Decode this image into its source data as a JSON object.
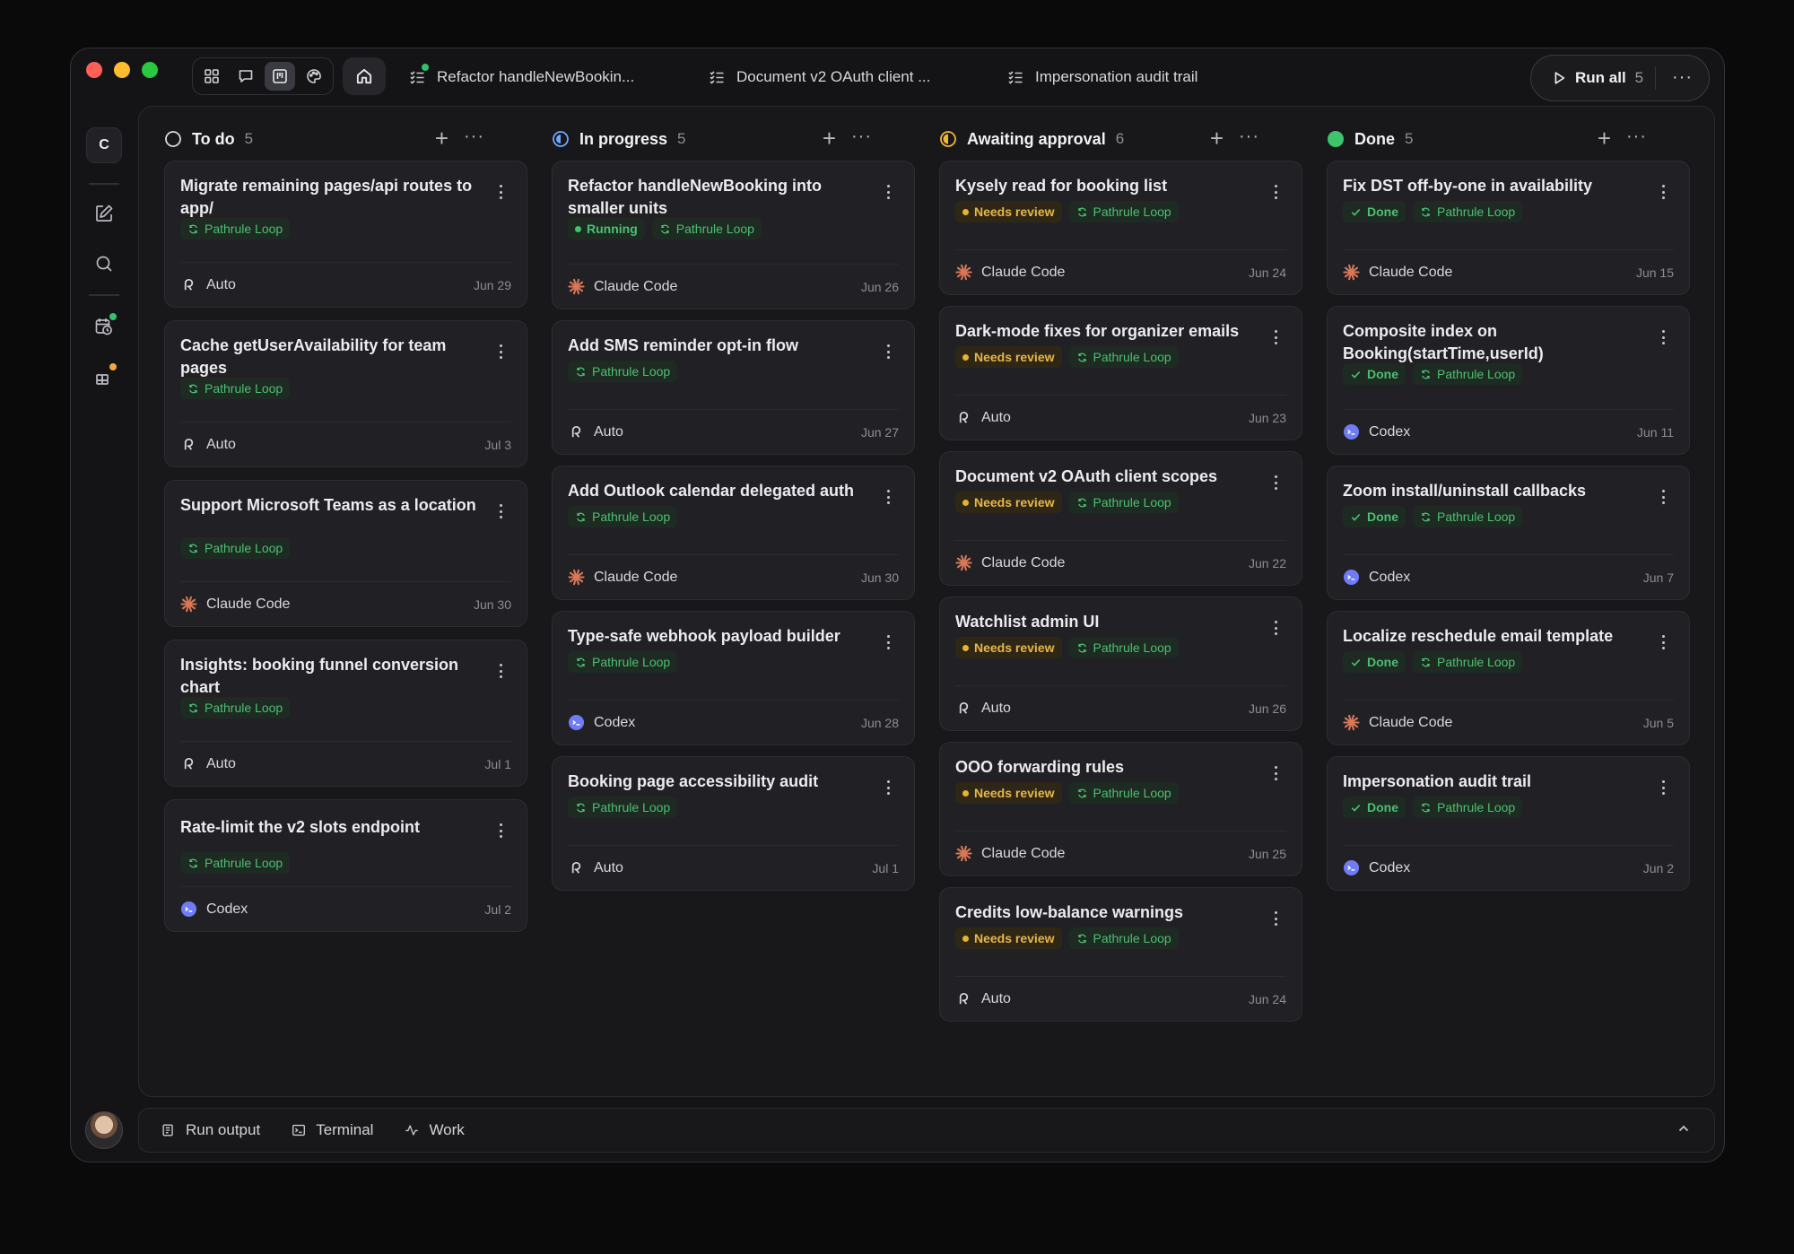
{
  "tabs": [
    {
      "label": "Refactor handleNewBookin...",
      "running": true
    },
    {
      "label": "Document v2 OAuth client ..."
    },
    {
      "label": "Impersonation audit trail"
    }
  ],
  "toolbar": {
    "run_all_label": "Run all",
    "run_all_count": "5"
  },
  "sidebar": {
    "workspace_initial": "C"
  },
  "columns": [
    {
      "name": "To do",
      "count": "5",
      "status_color": "#d8d8dc",
      "cards": [
        {
          "title": "Migrate remaining pages/api routes to app/",
          "tags": [
            "Pathrule Loop"
          ],
          "agent": "Auto",
          "date": "Jun 29"
        },
        {
          "title": "Cache getUserAvailability for team pages",
          "tags": [
            "Pathrule Loop"
          ],
          "agent": "Auto",
          "date": "Jul 3"
        },
        {
          "title": "Support Microsoft Teams as a location",
          "tags": [
            "Pathrule Loop"
          ],
          "agent": "Claude Code",
          "date": "Jun 30"
        },
        {
          "title": "Insights: booking funnel conversion chart",
          "tags": [
            "Pathrule Loop"
          ],
          "agent": "Auto",
          "date": "Jul 1"
        },
        {
          "title": "Rate-limit the v2 slots endpoint",
          "tags": [
            "Pathrule Loop"
          ],
          "agent": "Codex",
          "date": "Jul 2"
        }
      ]
    },
    {
      "name": "In progress",
      "count": "5",
      "status_color": "#6ea8ff",
      "cards": [
        {
          "title": "Refactor handleNewBooking into smaller units",
          "status": "Running",
          "tags": [
            "Pathrule Loop"
          ],
          "agent": "Claude Code",
          "date": "Jun 26"
        },
        {
          "title": "Add SMS reminder opt-in flow",
          "tags": [
            "Pathrule Loop"
          ],
          "agent": "Auto",
          "date": "Jun 27"
        },
        {
          "title": "Add Outlook calendar delegated auth",
          "tags": [
            "Pathrule Loop"
          ],
          "agent": "Claude Code",
          "date": "Jun 30"
        },
        {
          "title": "Type-safe webhook payload builder",
          "tags": [
            "Pathrule Loop"
          ],
          "agent": "Codex",
          "date": "Jun 28"
        },
        {
          "title": "Booking page accessibility audit",
          "tags": [
            "Pathrule Loop"
          ],
          "agent": "Auto",
          "date": "Jul 1"
        }
      ]
    },
    {
      "name": "Awaiting approval",
      "count": "6",
      "status_color": "#f0b53a",
      "cards": [
        {
          "title": "Kysely read for booking list",
          "status": "Needs review",
          "tags": [
            "Pathrule Loop"
          ],
          "agent": "Claude Code",
          "date": "Jun 24"
        },
        {
          "title": "Dark-mode fixes for organizer emails",
          "status": "Needs review",
          "tags": [
            "Pathrule Loop"
          ],
          "agent": "Auto",
          "date": "Jun 23"
        },
        {
          "title": "Document v2 OAuth client scopes",
          "status": "Needs review",
          "tags": [
            "Pathrule Loop"
          ],
          "agent": "Claude Code",
          "date": "Jun 22"
        },
        {
          "title": "Watchlist admin UI",
          "status": "Needs review",
          "tags": [
            "Pathrule Loop"
          ],
          "agent": "Auto",
          "date": "Jun 26"
        },
        {
          "title": "OOO forwarding rules",
          "status": "Needs review",
          "tags": [
            "Pathrule Loop"
          ],
          "agent": "Claude Code",
          "date": "Jun 25"
        },
        {
          "title": "Credits low-balance warnings",
          "status": "Needs review",
          "tags": [
            "Pathrule Loop"
          ],
          "agent": "Auto",
          "date": "Jun 24"
        }
      ]
    },
    {
      "name": "Done",
      "count": "5",
      "status_color": "#3ec46d",
      "cards": [
        {
          "title": "Fix DST off-by-one in availability",
          "status": "Done",
          "tags": [
            "Pathrule Loop"
          ],
          "agent": "Claude Code",
          "date": "Jun 15"
        },
        {
          "title": "Composite index on Booking(startTime,userId)",
          "status": "Done",
          "tags": [
            "Pathrule Loop"
          ],
          "agent": "Codex",
          "date": "Jun 11"
        },
        {
          "title": "Zoom install/uninstall callbacks",
          "status": "Done",
          "tags": [
            "Pathrule Loop"
          ],
          "agent": "Codex",
          "date": "Jun 7"
        },
        {
          "title": "Localize reschedule email template",
          "status": "Done",
          "tags": [
            "Pathrule Loop"
          ],
          "agent": "Claude Code",
          "date": "Jun 5"
        },
        {
          "title": "Impersonation audit trail",
          "status": "Done",
          "tags": [
            "Pathrule Loop"
          ],
          "agent": "Codex",
          "date": "Jun 2"
        }
      ]
    }
  ],
  "bottom_panel": {
    "tabs": [
      "Run output",
      "Terminal",
      "Work"
    ]
  },
  "colors": {
    "accent_green": "#4fbf73",
    "review_amber": "#e8b64a",
    "claude_orange": "#d97757",
    "codex_blue": "#6f7cf6"
  }
}
